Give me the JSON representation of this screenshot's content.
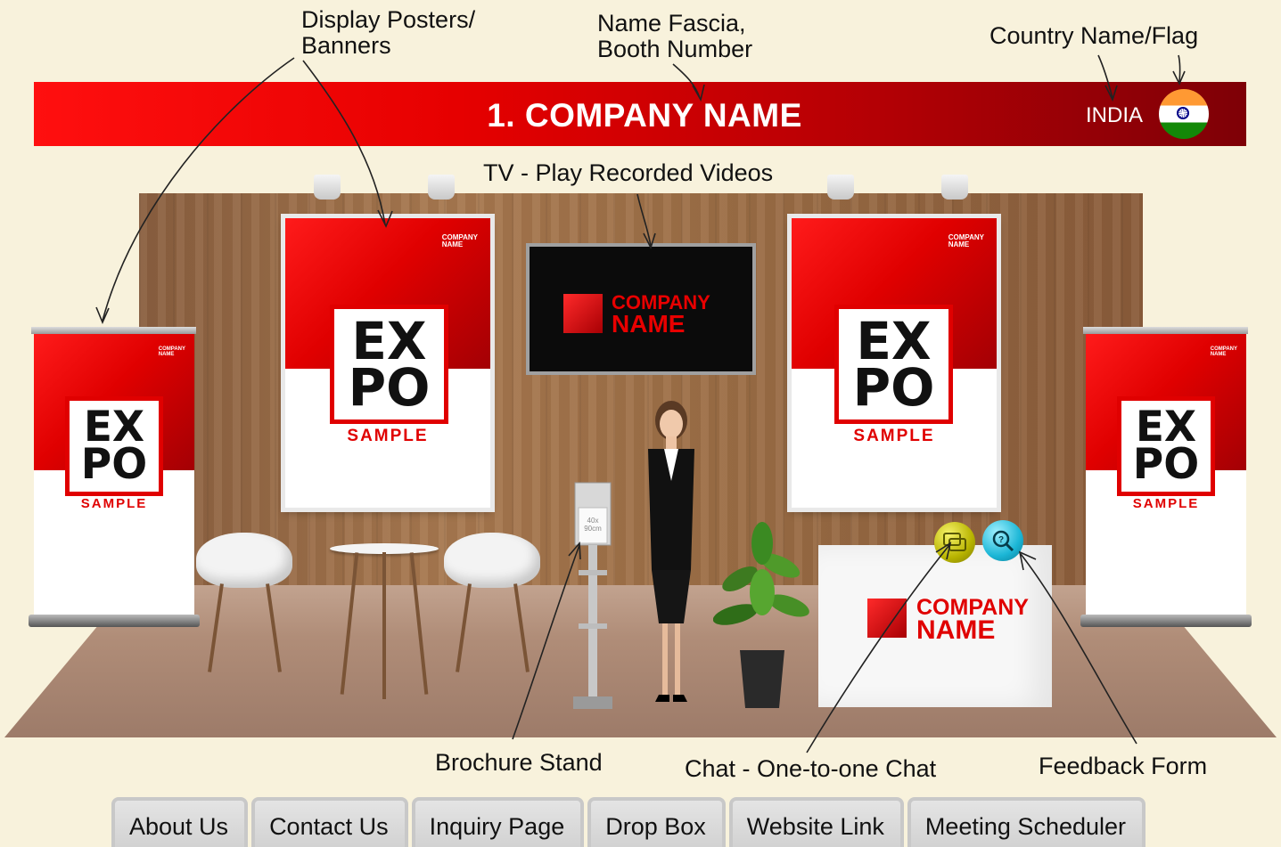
{
  "annotations": {
    "display_posters": "Display Posters/\nBanners",
    "display_posters_line1": "Display Posters/",
    "display_posters_line2": "Banners",
    "name_fascia_line1": "Name Fascia,",
    "name_fascia_line2": "Booth Number",
    "country_flag": "Country Name/Flag",
    "tv": "TV - Play Recorded Videos",
    "brochure_stand": "Brochure Stand",
    "chat": "Chat - One-to-one Chat",
    "feedback": "Feedback Form"
  },
  "fascia": {
    "title": "1. COMPANY NAME",
    "country": "INDIA",
    "flag_icon": "india-flag-icon"
  },
  "booth": {
    "company_line1": "COMPANY",
    "company_line2": "NAME",
    "expo_line1": "EX",
    "expo_line2": "PO",
    "sample": "SAMPLE",
    "brochure_text": "40x 90cm"
  },
  "icons": {
    "chat": "chat-bubble-icon",
    "feedback": "question-search-icon"
  },
  "colors": {
    "background": "#f8f2dc",
    "fascia_red": "#e60000",
    "brand_red": "#e00000"
  },
  "tabs": [
    {
      "label": "About Us"
    },
    {
      "label": "Contact Us"
    },
    {
      "label": "Inquiry Page"
    },
    {
      "label": "Drop Box"
    },
    {
      "label": "Website Link"
    },
    {
      "label": "Meeting Scheduler"
    }
  ]
}
